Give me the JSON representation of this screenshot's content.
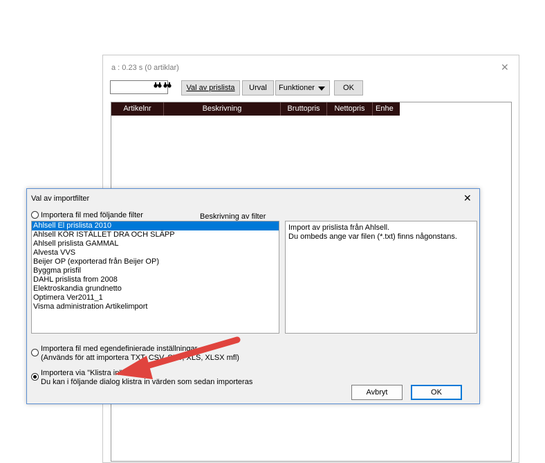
{
  "background_window": {
    "title": "a : 0.23 s (0 artiklar)",
    "close_glyph": "✕",
    "toolbar": {
      "search_value": "",
      "val_av_prislista": "Val av prislista",
      "urval": "Urval",
      "funktioner": "Funktioner",
      "ok": "OK"
    },
    "grid_columns": [
      "Artikelnr",
      "Beskrivning",
      "Bruttopris",
      "Nettopris",
      "Enhe"
    ]
  },
  "dialog": {
    "title": "Val av importfilter",
    "close_glyph": "✕",
    "option_filter_label": "Importera fil med följande filter",
    "description_header": "Beskrivning av filter",
    "filters": [
      "Ahlsell El prislista 2010",
      "Ahlsell KÖR ISTÄLLET DRA OCH SLÄPP",
      "Ahlsell prislista GAMMAL",
      "Alvesta VVS",
      "Beijer OP (exporterad från Beijer OP)",
      "Byggma prisfil",
      "DAHL prislista from 2008",
      "Elektroskandia grundnetto",
      "Optimera Ver2011_1",
      "Visma administration Artikelimport"
    ],
    "selected_filter_index": 0,
    "description_lines": [
      "Import av prislista från Ahlsell.",
      "Du ombeds ange var filen (*.txt) finns någonstans."
    ],
    "option_custom_line1": "Importera fil med egendefinierade inställningar",
    "option_custom_line2": "(Används för att importera TXT, CSV, SKV, XLS, XLSX mfl)",
    "option_paste_line1": "Importera via \"Klistra in\"",
    "option_paste_line2": "Du kan i följande dialog klistra in värden som sedan importeras",
    "selected_option": "paste",
    "cancel_label": "Avbryt",
    "ok_label": "OK"
  },
  "colors": {
    "accent": "#0078d7",
    "grid_header": "#2d0f0f",
    "annotation_arrow": "#e0443e"
  }
}
